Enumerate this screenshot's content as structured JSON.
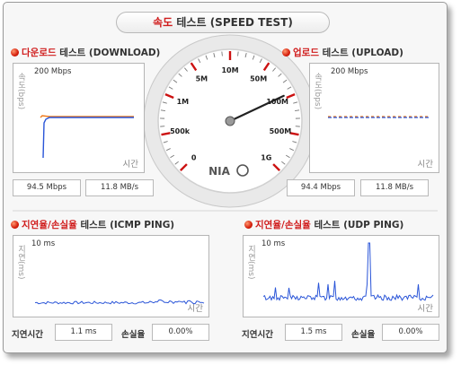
{
  "title": {
    "prefix": "속도",
    "rest": " 테스트 (SPEED TEST)"
  },
  "download": {
    "heading_prefix": "다운로드",
    "heading_rest": " 테스트 (DOWNLOAD)",
    "y_axis_label": "속도(bps)",
    "max_label": "200 Mbps",
    "x_axis_label": "시간",
    "value_mbps": "94.5 Mbps",
    "value_mb_s": "11.8 MB/s"
  },
  "upload": {
    "heading_prefix": "업로드",
    "heading_rest": " 테스트 (UPLOAD)",
    "y_axis_label": "속도(bps)",
    "max_label": "200 Mbps",
    "x_axis_label": "시간",
    "value_mbps": "94.4 Mbps",
    "value_mb_s": "11.8 MB/s"
  },
  "gauge": {
    "logo": "NIA",
    "scale_labels": [
      "0",
      "500k",
      "1M",
      "5M",
      "10M",
      "50M",
      "100M",
      "500M",
      "1G"
    ],
    "needle_mbps": 94.5,
    "colors": {
      "red_tick": "#cc1111",
      "needle": "#222222"
    }
  },
  "icmp": {
    "heading_prefix": "지연율/손실율",
    "heading_rest": " 테스트 (ICMP PING)",
    "y_axis_label": "지연(ms)",
    "max_label": "10 ms",
    "x_axis_label": "시간",
    "latency_label": "지연시간",
    "latency_value": "1.1 ms",
    "loss_label": "손실율",
    "loss_value": "0.00%"
  },
  "udp": {
    "heading_prefix": "지연율/손실율",
    "heading_rest": " 테스트 (UDP PING)",
    "y_axis_label": "지연(ms)",
    "max_label": "10 ms",
    "x_axis_label": "시간",
    "latency_label": "지연시간",
    "latency_value": "1.5 ms",
    "loss_label": "손실율",
    "loss_value": "0.00%"
  },
  "colors": {
    "accent_red": "#d01c1c",
    "series_blue": "#2a55d8",
    "series_orange": "#f07a1a"
  }
}
